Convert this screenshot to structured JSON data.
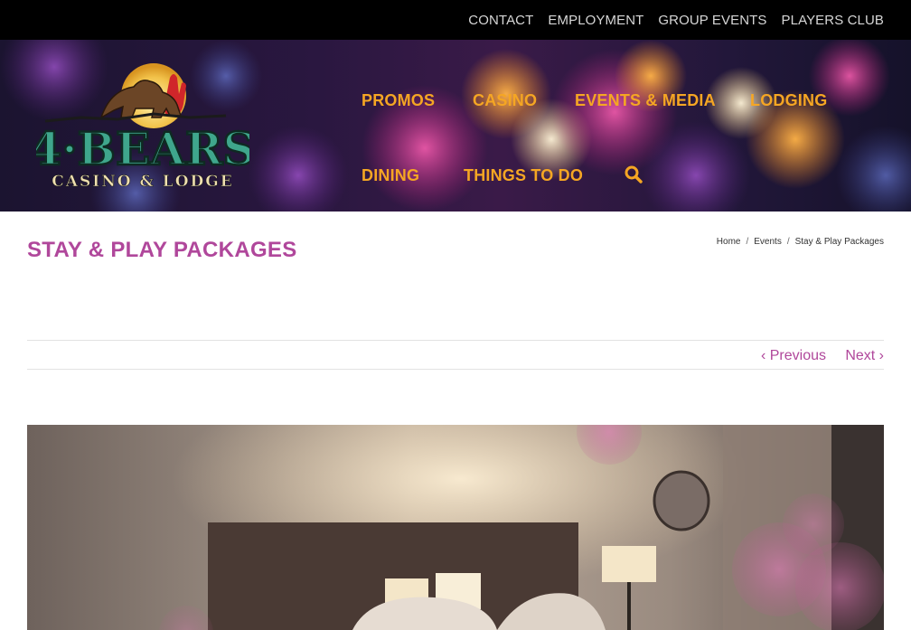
{
  "topbar": {
    "links": [
      "CONTACT",
      "EMPLOYMENT",
      "GROUP EVENTS",
      "PLAYERS CLUB"
    ]
  },
  "logo": {
    "line1": "4·BEARS",
    "line2": "CASINO & LODGE"
  },
  "nav": {
    "row1": [
      "PROMOS",
      "CASINO",
      "EVENTS & MEDIA",
      "LODGING"
    ],
    "row2": [
      "DINING",
      "THINGS TO DO"
    ],
    "search_icon": "search-icon"
  },
  "page": {
    "title": "STAY & PLAY PACKAGES",
    "breadcrumb": [
      "Home",
      "Events",
      "Stay & Play Packages"
    ],
    "breadcrumb_sep": "/",
    "prev_label": "Previous",
    "next_label": "Next",
    "prev_icon": "‹",
    "next_icon": "›"
  },
  "colors": {
    "accent_purple": "#b0479b",
    "nav_orange": "#f5a623",
    "topbar_bg": "#000000"
  }
}
